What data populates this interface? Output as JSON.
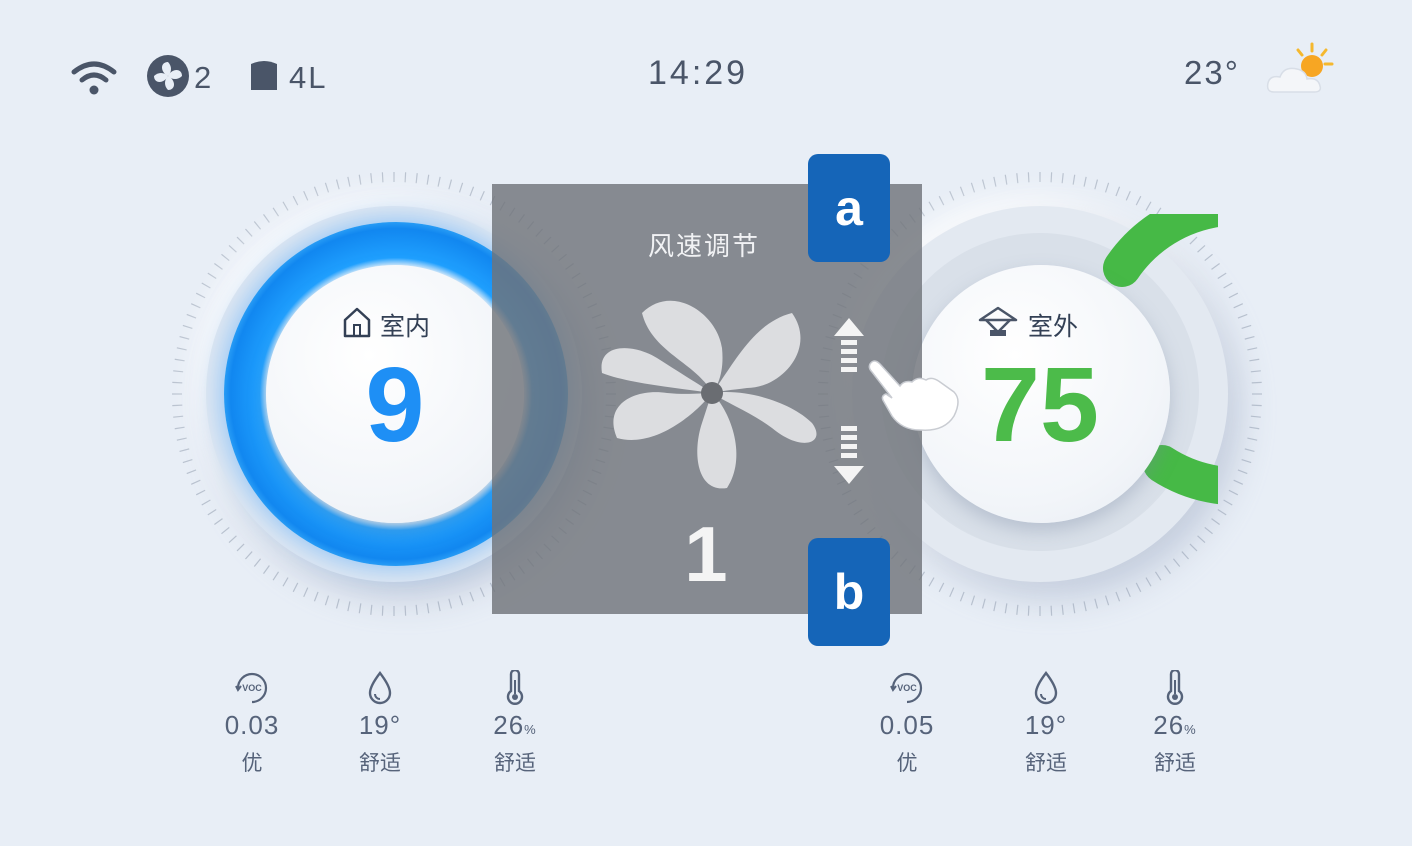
{
  "status_bar": {
    "fan_count": "2",
    "filter_volume": "4L",
    "time": "14:29",
    "temperature": "23°",
    "weather_icon": "partly-cloudy-icon"
  },
  "indoor": {
    "label": "室内",
    "value": "9",
    "icon": "home-icon",
    "ring_color": "#1e8ff5",
    "stats": [
      {
        "icon": "voc-icon",
        "value": "0.03",
        "label": "优"
      },
      {
        "icon": "humidity-drop-icon",
        "value": "19°",
        "label": "舒适"
      },
      {
        "icon": "thermometer-icon",
        "value": "26",
        "unit": "%",
        "label": "舒适"
      }
    ]
  },
  "outdoor": {
    "label": "室外",
    "value": "75",
    "icon": "outdoor-building-icon",
    "ring_color": "#4cbb4a",
    "stats": [
      {
        "icon": "voc-icon",
        "value": "0.05",
        "label": "优"
      },
      {
        "icon": "humidity-drop-icon",
        "value": "19°",
        "label": "舒适"
      },
      {
        "icon": "thermometer-icon",
        "value": "26",
        "unit": "%",
        "label": "舒适"
      }
    ]
  },
  "fan_panel": {
    "title": "风速调节",
    "speed": "1",
    "callout_top": "a",
    "callout_bottom": "b"
  }
}
